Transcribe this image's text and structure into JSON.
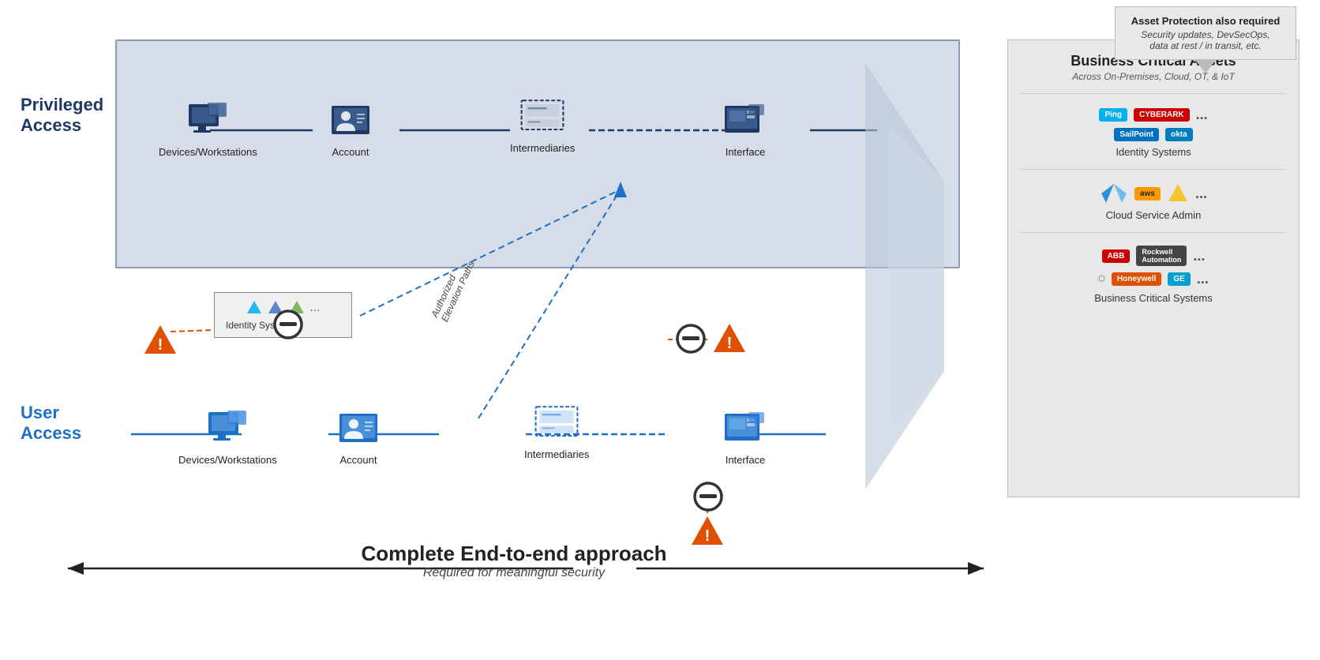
{
  "assetProtection": {
    "title": "Asset Protection also required",
    "subtitle": "Security updates, DevSecOps,\ndata at rest / in transit, etc."
  },
  "labels": {
    "privilegedAccess": "Privileged Access",
    "userAccess": "User Access"
  },
  "privilegedRow": {
    "devices": "Devices/Workstations",
    "account": "Account",
    "intermediaries": "Intermediaries",
    "interface": "Interface"
  },
  "userRow": {
    "devices": "Devices/Workstations",
    "account": "Account",
    "intermediaries": "Intermediaries",
    "interface": "Interface"
  },
  "identitySystems": "Identity Systems",
  "elevationLabel": "Authorized\nElevation Paths",
  "bca": {
    "title": "Business Critical Assets",
    "subtitle": "Across On-Premises, Cloud, OT, & IoT",
    "sections": [
      {
        "label": "Identity Systems",
        "logos": [
          "Ping",
          "CyberArk",
          "SailPoint",
          "okta",
          "..."
        ]
      },
      {
        "label": "Cloud Service Admin",
        "logos": [
          "azure",
          "aws",
          "⬡",
          "..."
        ]
      },
      {
        "label": "Business Critical Systems",
        "logos": [
          "ABB",
          "Rockwell Automation",
          "⬡",
          "Honeywell",
          "GE",
          "..."
        ]
      }
    ]
  },
  "bottom": {
    "title": "Complete End-to-end approach",
    "subtitle": "Required for meaningful security"
  }
}
